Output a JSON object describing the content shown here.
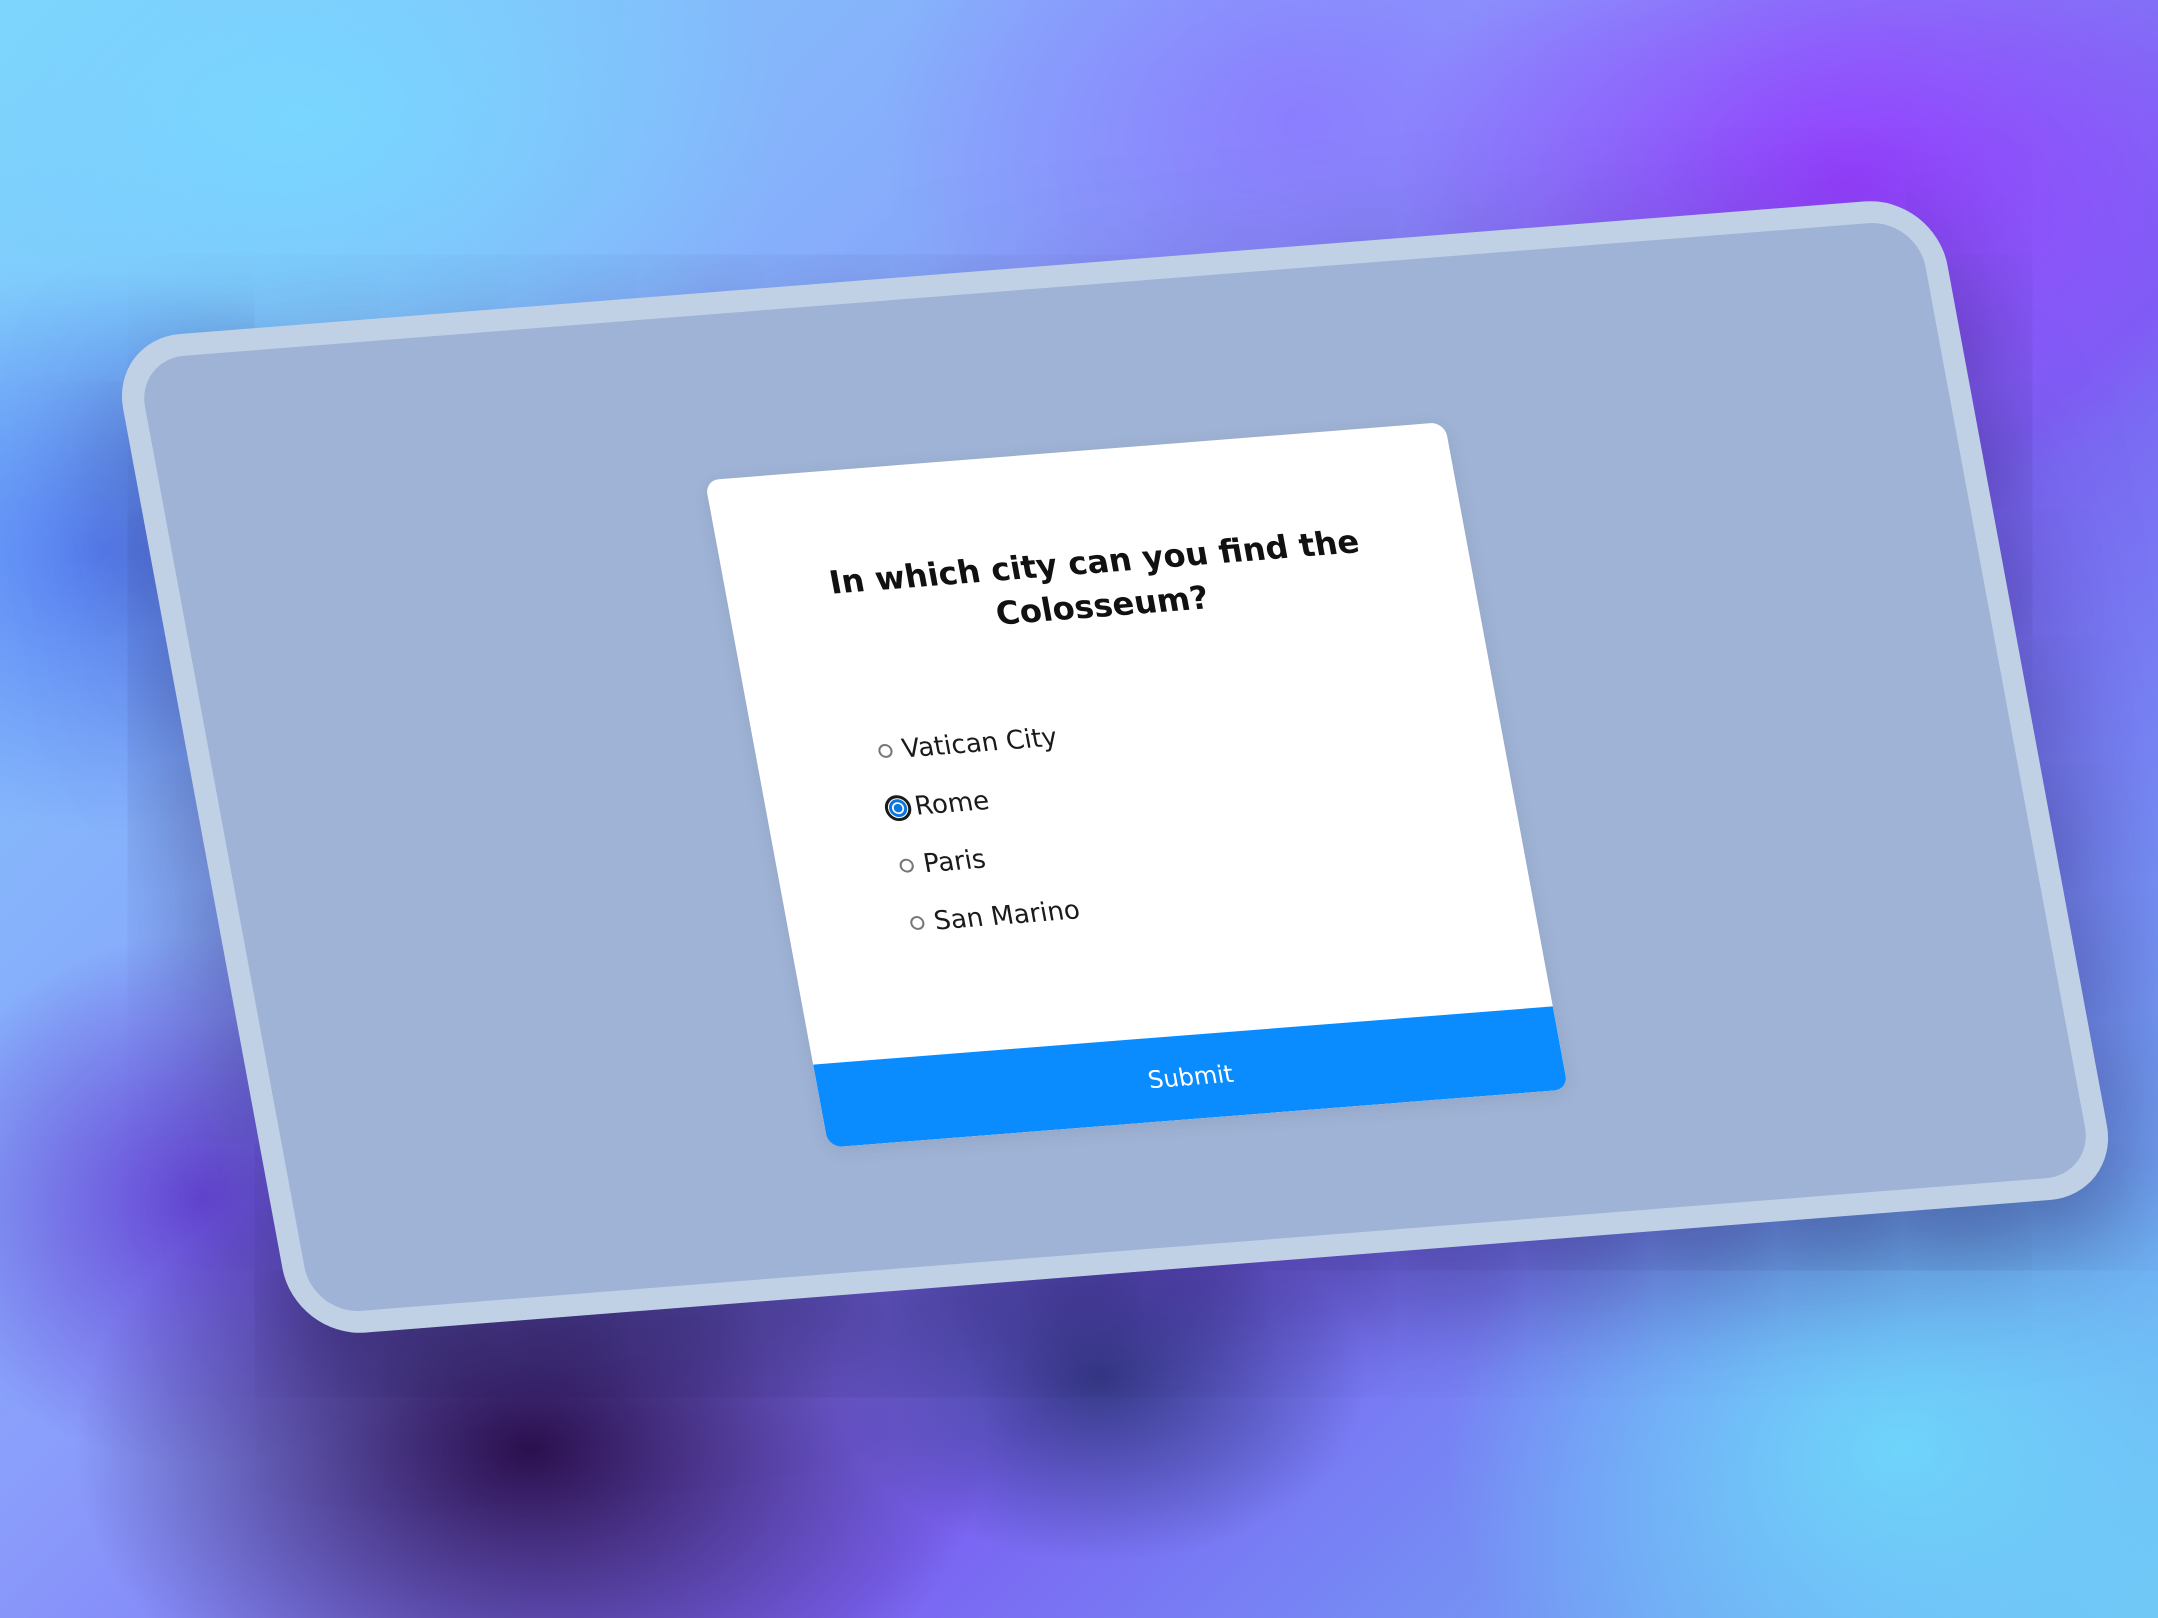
{
  "quiz": {
    "question": "In which city can you find the Colosseum?",
    "options": [
      {
        "label": "Vatican City",
        "selected": false
      },
      {
        "label": "Rome",
        "selected": true
      },
      {
        "label": "Paris",
        "selected": false
      },
      {
        "label": "San Marino",
        "selected": false
      }
    ],
    "submit_label": "Submit"
  },
  "colors": {
    "accent": "#0a8cff",
    "device_screen": "#9fb3d6",
    "card_background": "#ffffff",
    "radio_selected": "#0b76e0"
  }
}
